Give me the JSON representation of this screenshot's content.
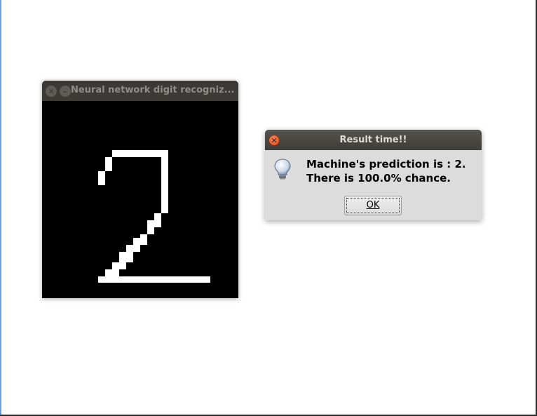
{
  "canvas_window": {
    "title": "Neural network digit recogniz...",
    "drawn_digit": "2"
  },
  "dialog": {
    "title": "Result time!!",
    "line1": "Machine's prediction is : 2.",
    "line2": "There is 100.0% chance.",
    "ok_label": "OK",
    "icon": "lightbulb-icon"
  },
  "colors": {
    "titlebar": "#3b3a36",
    "dialog_bg": "#dcdcdc",
    "close_button": "#df4b16",
    "canvas_bg": "#000000",
    "stroke": "#ffffff"
  }
}
